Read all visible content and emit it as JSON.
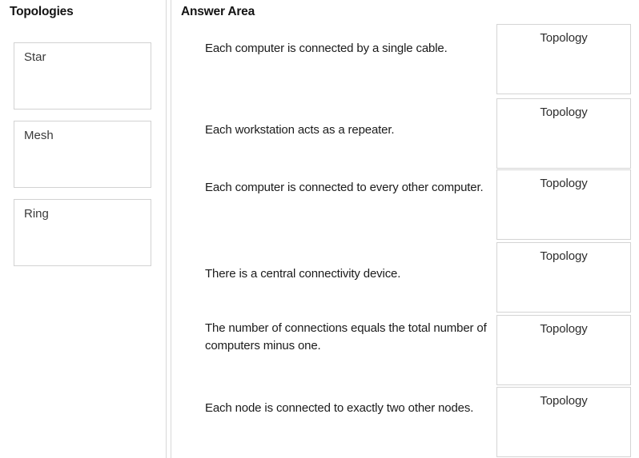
{
  "left_panel": {
    "title": "Topologies",
    "items": [
      {
        "label": "Star"
      },
      {
        "label": "Mesh"
      },
      {
        "label": "Ring"
      }
    ]
  },
  "answer_panel": {
    "title": "Answer Area",
    "rows": [
      {
        "statement": "Each computer is connected by a single cable.",
        "selected": "Topology"
      },
      {
        "statement": "Each workstation acts as a repeater.",
        "selected": "Topology"
      },
      {
        "statement": "Each computer is connected to every other computer.",
        "selected": "Topology"
      },
      {
        "statement": "There is a central connectivity device.",
        "selected": "Topology"
      },
      {
        "statement": "The number of connections equals the total number of computers minus one.",
        "selected": "Topology"
      },
      {
        "statement": "Each node is connected to exactly two other nodes.",
        "selected": "Topology"
      }
    ]
  },
  "colors": {
    "background": "#ffffff",
    "box_border": "#d2d2d2",
    "divider": "#d8d8d8",
    "text": "#1a1a1a"
  }
}
